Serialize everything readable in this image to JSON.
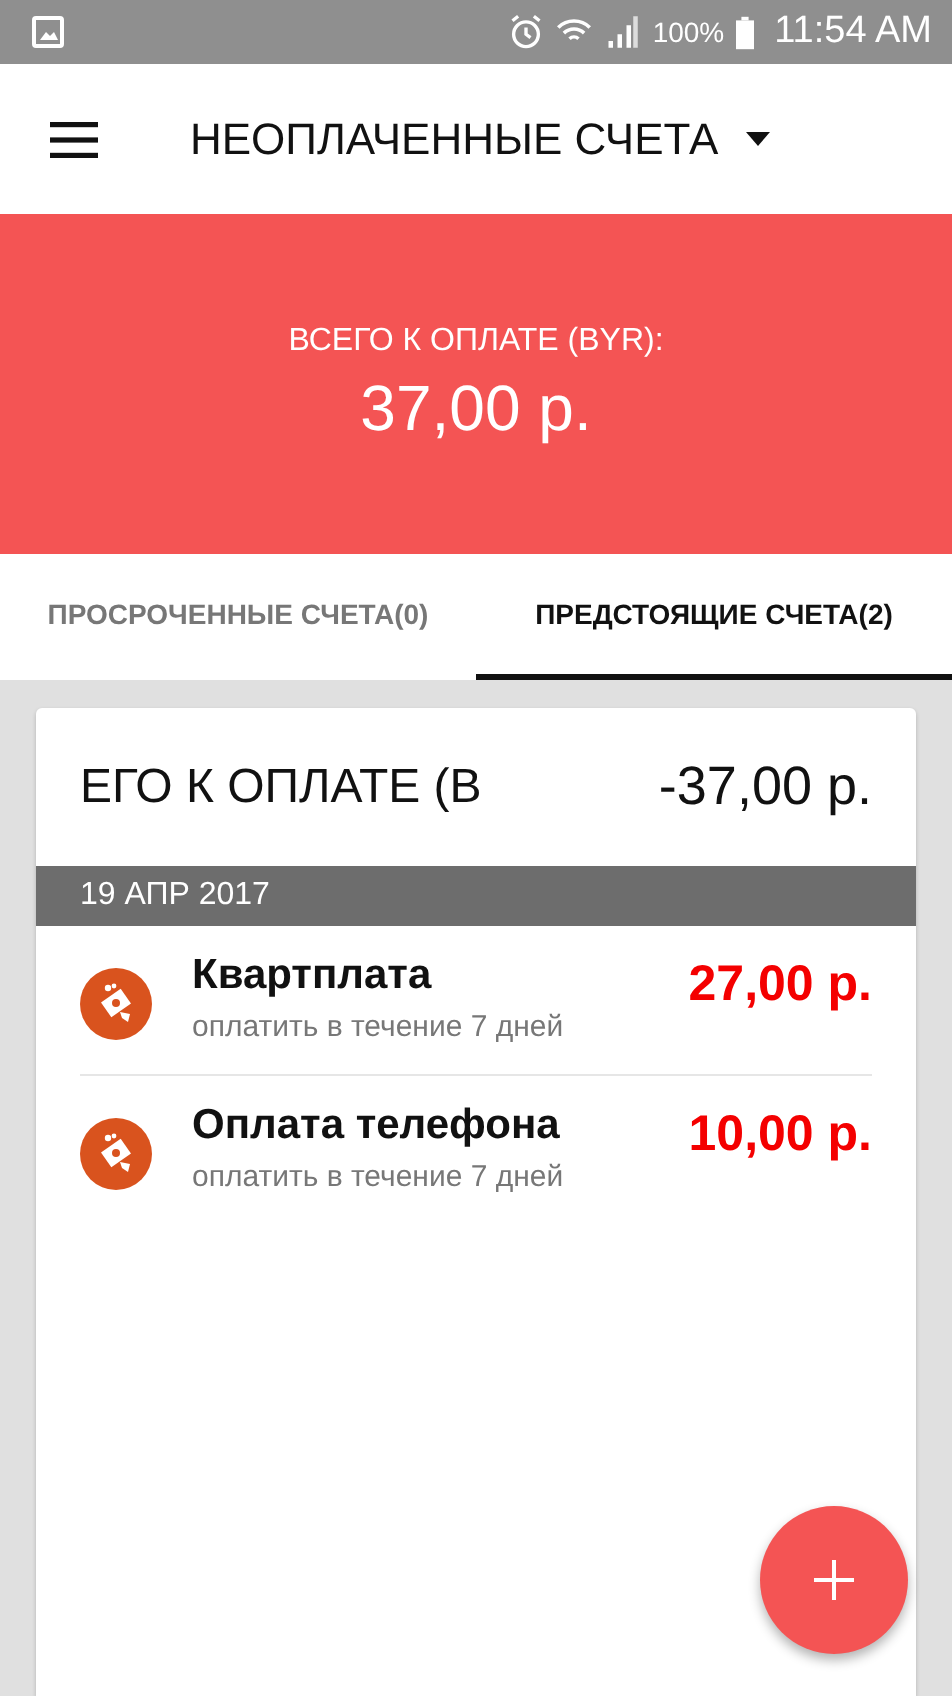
{
  "status_bar": {
    "battery": "100%",
    "time": "11:54 AM"
  },
  "app_bar": {
    "title": "НЕОПЛАЧЕННЫЕ СЧЕТА"
  },
  "summary": {
    "label": "ВСЕГО К ОПЛАТЕ (BYR):",
    "amount": "37,00 р."
  },
  "tabs": [
    {
      "label": "ПРОСРОЧЕННЫЕ СЧЕТА(0)",
      "selected": false
    },
    {
      "label": "ПРЕДСТОЯЩИЕ СЧЕТА(2)",
      "selected": true
    }
  ],
  "card": {
    "total_label": "ЕГО К ОПЛАТЕ (B",
    "total_amount": "-37,00 р.",
    "date": "19 АПР 2017",
    "bills": [
      {
        "name": "Квартплата",
        "note": "оплатить в течение 7 дней",
        "amount": "27,00 р."
      },
      {
        "name": "Оплата телефона",
        "note": "оплатить в течение 7 дней",
        "amount": "10,00 р."
      }
    ]
  }
}
